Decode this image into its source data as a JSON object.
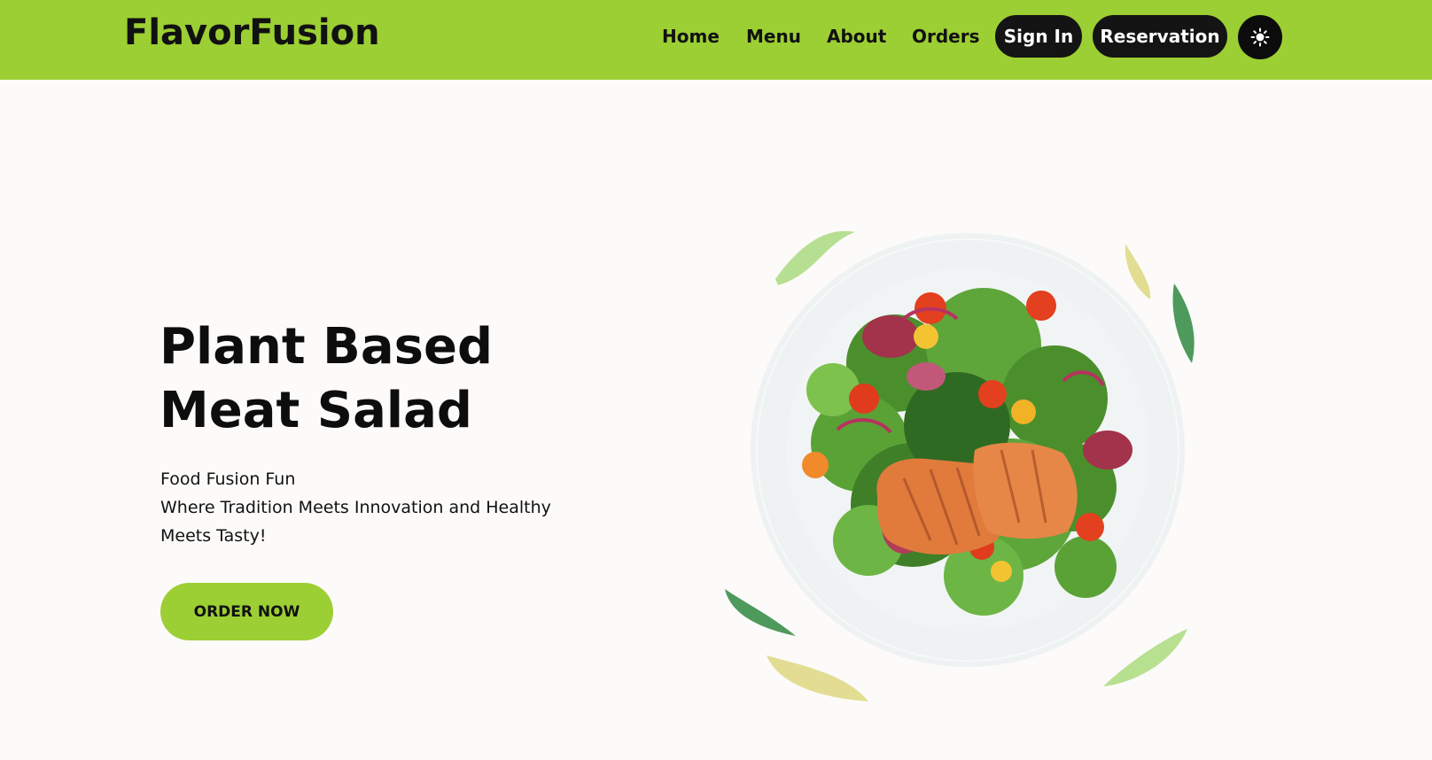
{
  "brand": {
    "name": "FlavorFusion",
    "accent": "#9ccf33",
    "dark": "#151414"
  },
  "nav": {
    "links": [
      "Home",
      "Menu",
      "About",
      "Orders"
    ],
    "sign_in": "Sign In",
    "reservation": "Reservation",
    "theme_icon": "sun-icon"
  },
  "hero": {
    "title_lines": [
      "Plant Based",
      "Meat Salad"
    ],
    "subtitle_lines": [
      "Food Fusion Fun",
      "Where Tradition Meets Innovation and Healthy",
      "Meets Tasty!"
    ],
    "cta": "ORDER NOW",
    "image_subject": "salmon-salad-plate"
  }
}
